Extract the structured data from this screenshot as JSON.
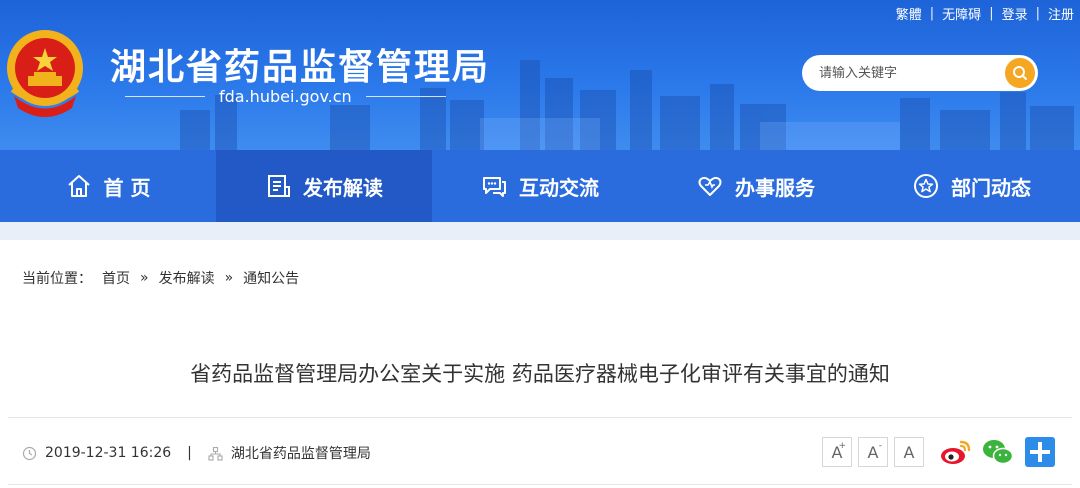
{
  "header": {
    "site_title": "湖北省药品监督管理局",
    "domain": "fda.hubei.gov.cn",
    "top_links": [
      "繁體",
      "无障碍",
      "登录",
      "注册"
    ],
    "search": {
      "placeholder": "请输入关键字"
    }
  },
  "nav": {
    "items": [
      {
        "label": "首 页",
        "icon": "home-icon"
      },
      {
        "label": "发布解读",
        "icon": "document-icon"
      },
      {
        "label": "互动交流",
        "icon": "chat-icon"
      },
      {
        "label": "办事服务",
        "icon": "heart-icon"
      },
      {
        "label": "部门动态",
        "icon": "star-icon"
      }
    ],
    "active_index": 1
  },
  "breadcrumb": {
    "prefix": "当前位置：",
    "items": [
      "首页",
      "发布解读",
      "通知公告"
    ],
    "separator": "»"
  },
  "article": {
    "title": "省药品监督管理局办公室关于实施 药品医疗器械电子化审评有关事宜的通知",
    "date": "2019-12-31 16:26",
    "separator": "|",
    "source": "湖北省药品监督管理局"
  },
  "tools": {
    "font_buttons": [
      {
        "label": "A",
        "sup": "+"
      },
      {
        "label": "A",
        "sup": "-"
      },
      {
        "label": "A",
        "sup": ""
      }
    ],
    "share": [
      "weibo-icon",
      "wechat-icon",
      "plus-share-icon"
    ]
  },
  "colors": {
    "header_blue": "#2a78ea",
    "nav_blue": "#2a6cde",
    "nav_active": "#2259c6",
    "search_button": "#f5a623",
    "share_blue": "#2d8ce8",
    "weibo": "#e6162d",
    "wechat": "#3bb43b"
  }
}
